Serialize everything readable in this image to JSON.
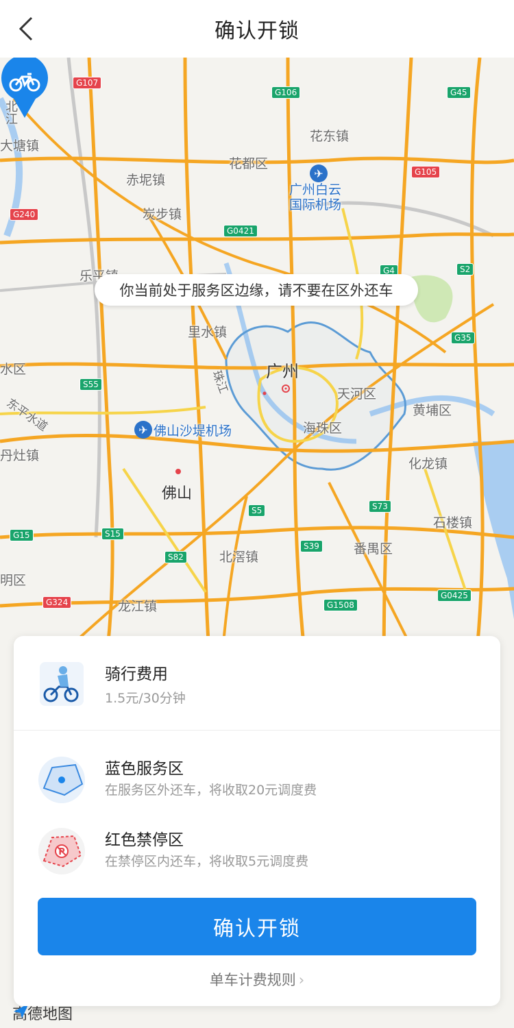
{
  "header": {
    "title": "确认开锁",
    "back_icon": "chevron-left-icon"
  },
  "map": {
    "tip": "你当前处于服务区边缘，请不要在区外还车",
    "pin_icon": "bicycle-icon",
    "labels": {
      "beijiang": "北江",
      "datang": "大塘镇",
      "chini": "赤坭镇",
      "huadu": "花都区",
      "huadong": "花东镇",
      "tanbu": "炭步镇",
      "airport_baiyun": "广州白云国际机场",
      "leping": "乐平镇",
      "lishui": "里水镇",
      "guangzhou": "广州",
      "tianhe": "天河区",
      "huangpu": "黄埔区",
      "haizhu": "海珠区",
      "zhujiang": "珠江",
      "shuiqu": "水区",
      "dongping": "东平水道",
      "airport_foshan": "佛山沙堤机场",
      "danzao": "丹灶镇",
      "foshan": "佛山",
      "hualong": "化龙镇",
      "shilou": "石楼镇",
      "beijiao": "北滘镇",
      "panyu": "番禺区",
      "mingqu": "明区",
      "longjiang": "龙江镇"
    },
    "shields": {
      "g107": "G107",
      "g106": "G106",
      "g45": "G45",
      "g105": "G105",
      "g240": "G240",
      "g0421": "G0421",
      "g4": "G4",
      "s2": "S2",
      "g35": "G35",
      "s55": "S55",
      "s73": "S73",
      "s5": "S5",
      "g15": "G15",
      "s15": "S15",
      "s82": "S82",
      "s39": "S39",
      "g0425": "G0425",
      "g324": "G324",
      "g1508": "G1508"
    },
    "logo": "高德地图"
  },
  "card": {
    "fee": {
      "title": "骑行费用",
      "desc": "1.5元/30分钟",
      "icon": "cyclist-icon"
    },
    "blue": {
      "title": "蓝色服务区",
      "desc": "在服务区外还车，将收取20元调度费",
      "icon": "blue-zone-icon"
    },
    "red": {
      "title": "红色禁停区",
      "desc": "在禁停区内还车，将收取5元调度费",
      "icon": "no-parking-zone-icon"
    },
    "confirm_label": "确认开锁",
    "rules_label": "单车计费规则"
  },
  "colors": {
    "primary": "#1a85ea",
    "highway": "#f5a623",
    "shield_green": "#19a46b",
    "shield_red": "#e5434b"
  }
}
